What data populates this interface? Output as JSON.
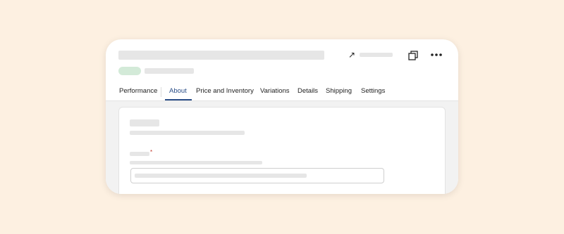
{
  "header": {
    "icons": {
      "external_link": "external-link-icon",
      "copy": "copy-icon",
      "more": "more-options-icon"
    }
  },
  "tabs": [
    {
      "label": "Performance",
      "active": false
    },
    {
      "label": "About",
      "active": true
    },
    {
      "label": "Price and Inventory",
      "active": false
    },
    {
      "label": "Variations",
      "active": false
    },
    {
      "label": "Details",
      "active": false
    },
    {
      "label": "Shipping",
      "active": false
    },
    {
      "label": "Settings",
      "active": false
    }
  ],
  "form": {
    "required_marker": "*"
  },
  "colors": {
    "page_background": "#fdf0e1",
    "active_tab": "#2a4d87",
    "status_pill": "#d3ead8",
    "required": "#c0392b"
  }
}
